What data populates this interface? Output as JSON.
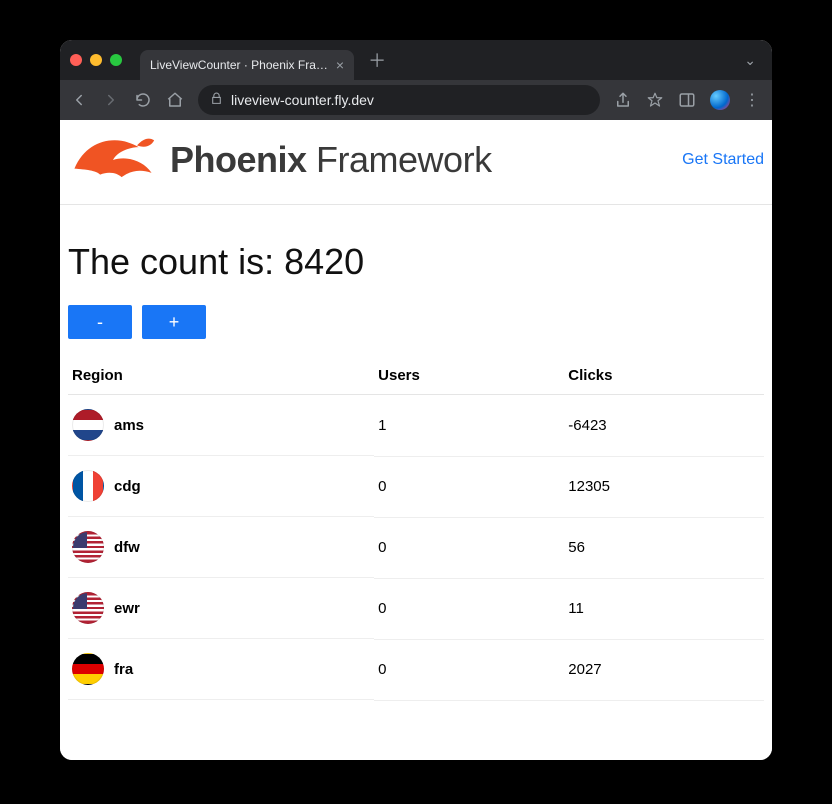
{
  "browser": {
    "tab_title": "LiveViewCounter · Phoenix Fra…",
    "url": "liveview-counter.fly.dev"
  },
  "header": {
    "brand_bold": "Phoenix",
    "brand_light": "Framework",
    "get_started": "Get Started"
  },
  "counter": {
    "label_prefix": "The count is: ",
    "value": "8420",
    "dec_label": "-",
    "inc_label": "+"
  },
  "table": {
    "columns": {
      "region": "Region",
      "users": "Users",
      "clicks": "Clicks"
    },
    "rows": [
      {
        "flag": "nl",
        "region": "ams",
        "users": "1",
        "clicks": "-6423"
      },
      {
        "flag": "fr",
        "region": "cdg",
        "users": "0",
        "clicks": "12305"
      },
      {
        "flag": "us",
        "region": "dfw",
        "users": "0",
        "clicks": "56"
      },
      {
        "flag": "us",
        "region": "ewr",
        "users": "0",
        "clicks": "11"
      },
      {
        "flag": "de",
        "region": "fra",
        "users": "0",
        "clicks": "2027"
      }
    ]
  }
}
